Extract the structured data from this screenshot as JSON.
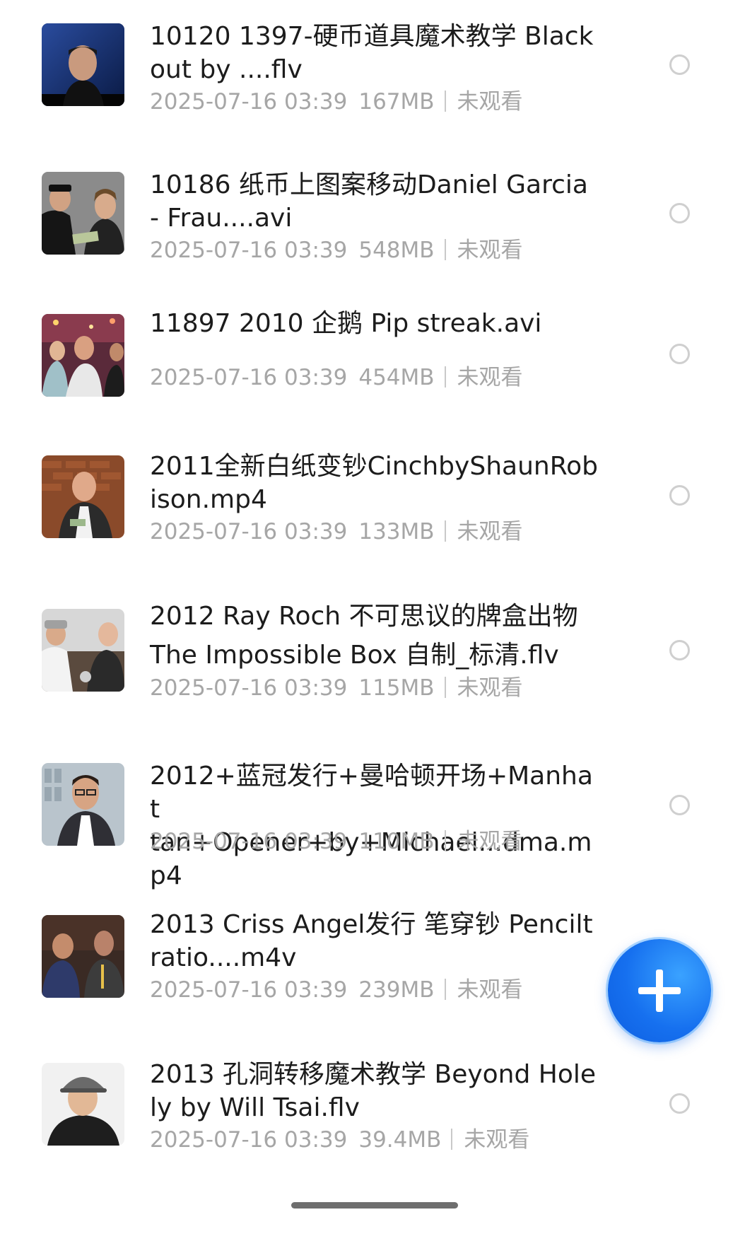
{
  "videos": [
    {
      "title": "10120 1397-硬币道具魔术教学 Black\nout by ....flv",
      "date": "2025-07-16 03:39",
      "size": "167MB",
      "status": "未观看",
      "thumb_icon": "thumbnail-man-blue-background"
    },
    {
      "title": "10186 纸币上图案移动Daniel Garcia\n- Frau....avi",
      "date": "2025-07-16 03:39",
      "size": "548MB",
      "status": "未观看",
      "thumb_icon": "thumbnail-two-men-banknote"
    },
    {
      "title": "11897 2010 企鹅 Pip streak.avi",
      "date": "2025-07-16 03:39",
      "size": "454MB",
      "status": "未观看",
      "thumb_icon": "thumbnail-street-crowd"
    },
    {
      "title": "2011全新白纸变钞CinchbyShaunRob\nison.mp4",
      "date": "2025-07-16 03:39",
      "size": "133MB",
      "status": "未观看",
      "thumb_icon": "thumbnail-man-brick-wall"
    },
    {
      "title": "2012 Ray Roch 不可思议的牌盒出物\nThe Impossible Box 自制_标清.flv",
      "date": "2025-07-16 03:39",
      "size": "115MB",
      "status": "未观看",
      "thumb_icon": "thumbnail-two-men-table"
    },
    {
      "title": "2012+蓝冠发行+曼哈顿开场+Manhat\ntan+Opener+by+Michael...dma.mp4",
      "date": "2025-07-16 03:39",
      "size": "110MB",
      "status": "未观看",
      "thumb_icon": "thumbnail-man-glasses"
    },
    {
      "title": "2013 Criss Angel发行 笔穿钞 Pencilt\nratio....m4v",
      "date": "2025-07-16 03:39",
      "size": "239MB",
      "status": "未观看",
      "thumb_icon": "thumbnail-two-men-pencil"
    },
    {
      "title": "2013 孔洞转移魔术教学 Beyond Hole\nly by Will Tsai.flv",
      "date": "2025-07-16 03:39",
      "size": "39.4MB",
      "status": "未观看",
      "thumb_icon": "thumbnail-man-grey-cap"
    }
  ],
  "fab": {
    "icon": "plus-icon",
    "color": "#1670ef"
  },
  "colors": {
    "title": "#1c1c1c",
    "meta": "#a6a6a6",
    "radio": "#cfcfcf"
  }
}
